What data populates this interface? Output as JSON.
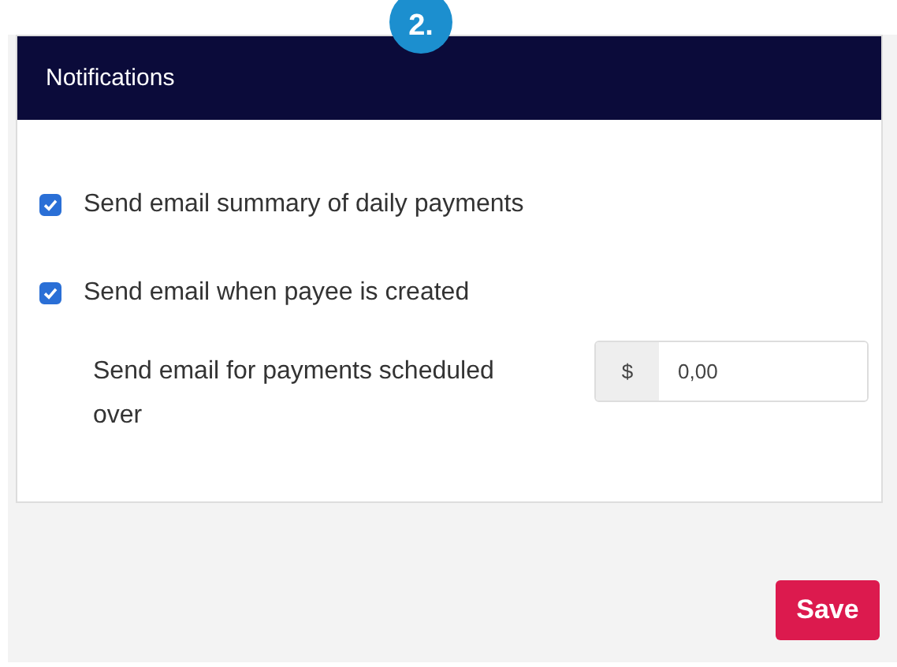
{
  "step_badge": "2.",
  "panel": {
    "title": "Notifications",
    "options": [
      {
        "kind": "checkbox",
        "label": "Send email summary of daily payments",
        "checked": true
      },
      {
        "kind": "checkbox",
        "label": "Send email when payee is created",
        "checked": true
      },
      {
        "kind": "amount",
        "label": "Send email for payments scheduled over",
        "prefix": "$",
        "value": "0,00"
      }
    ]
  },
  "buttons": [
    "Save"
  ]
}
